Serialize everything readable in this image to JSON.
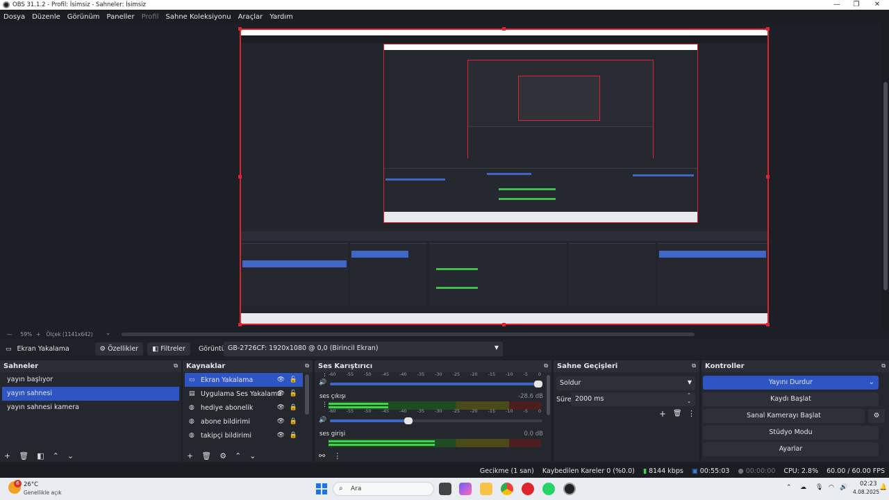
{
  "window": {
    "title": "OBS 31.1.2 - Profil: İsimsiz - Sahneler: İsimsiz",
    "controls": [
      "—",
      "❐",
      "✕"
    ]
  },
  "menu": {
    "items": [
      {
        "label": "Dosya",
        "disabled": false
      },
      {
        "label": "Düzenle",
        "disabled": false
      },
      {
        "label": "Görünüm",
        "disabled": false
      },
      {
        "label": "Paneller",
        "disabled": false
      },
      {
        "label": "Profil",
        "disabled": true
      },
      {
        "label": "Sahne Koleksiyonu",
        "disabled": false
      },
      {
        "label": "Araçlar",
        "disabled": false
      },
      {
        "label": "Yardım",
        "disabled": false
      }
    ]
  },
  "zoom": {
    "percent": "59%",
    "scale_label": "Ölçek (1141x642)"
  },
  "source_toolbar": {
    "source_name": "Ekran Yakalama",
    "properties_label": "Özellikler",
    "filters_label": "Filtreler",
    "display_label": "Görüntü",
    "display_value": "GB-2726CF: 1920x1080 @ 0,0 (Birincil Ekran)"
  },
  "scenes": {
    "title": "Sahneler",
    "items": [
      "yayın başlıyor",
      "yayın sahnesi",
      "yayın sahnesi kamera"
    ],
    "selected_index": 1
  },
  "sources": {
    "title": "Kaynaklar",
    "items": [
      {
        "label": "Ekran Yakalama",
        "icon": "monitor-icon",
        "selected": true
      },
      {
        "label": "Uygulama Ses Yakalama (BETA)",
        "icon": "app-audio-icon",
        "selected": false
      },
      {
        "label": "hediye abonelik",
        "icon": "globe-icon",
        "selected": false
      },
      {
        "label": "abone bildirimi",
        "icon": "globe-icon",
        "selected": false
      },
      {
        "label": "takipçi bildirimi",
        "icon": "globe-icon",
        "selected": false
      }
    ]
  },
  "mixer": {
    "title": "Ses Karıştırıcı",
    "ticks": [
      "-60",
      "-55",
      "-50",
      "-45",
      "-40",
      "-35",
      "-30",
      "-25",
      "-20",
      "-15",
      "-10",
      "-5",
      "0"
    ],
    "channels": [
      {
        "name": "",
        "db": "",
        "volume": 1.0,
        "level": 0.0
      },
      {
        "name": "ses çıkışı",
        "db": "-28.6 dB",
        "volume": 0.39,
        "level": 0.28
      },
      {
        "name": "ses girişi",
        "db": "0.0 dB",
        "volume": 1.0,
        "level": 0.5
      }
    ]
  },
  "transitions": {
    "title": "Sahne Geçişleri",
    "selected": "Soldur",
    "duration_label": "Süre",
    "duration_value": "2000 ms"
  },
  "controls": {
    "title": "Kontroller",
    "stop_stream": "Yayını Durdur",
    "start_record": "Kaydı Başlat",
    "start_virtualcam": "Sanal Kamerayı Başlat",
    "studio_mode": "Stüdyo Modu",
    "settings": "Ayarlar"
  },
  "status": {
    "delay": "Gecikme (1 san)",
    "dropped": "Kaybedilen Kareler 0 (%0.0)",
    "bitrate": "8144 kbps",
    "stream_time": "00:55:03",
    "record_time": "00:00:00",
    "cpu": "CPU: 2.8%",
    "fps": "60.00 / 60.00 FPS"
  },
  "taskbar": {
    "weather_temp": "26°C",
    "weather_desc": "Genellikle açık",
    "weather_badge": "6",
    "search_label": "Ara",
    "time": "02:23",
    "date": "4.08.2025"
  },
  "colors": {
    "accent": "#2d55c4",
    "capture_border": "#e0242d",
    "meter_green": "#3fd44b"
  }
}
